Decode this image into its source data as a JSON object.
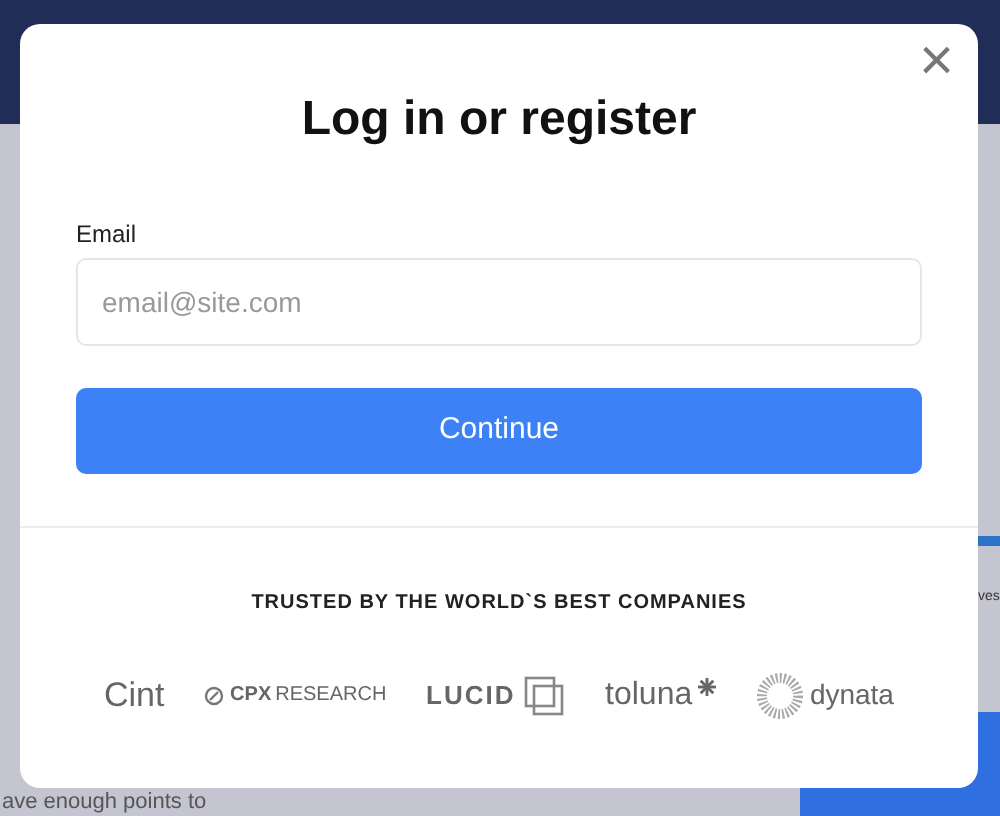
{
  "background": {
    "text_fragment": "ave enough points to",
    "side_fragment": "ves"
  },
  "modal": {
    "title": "Log in or register",
    "close": "×",
    "email": {
      "label": "Email",
      "placeholder": "email@site.com"
    },
    "button": "Continue",
    "trusted_title": "TRUSTED BY THE WORLD`S BEST COMPANIES",
    "logos": [
      {
        "kind": "cint",
        "text": "Cint"
      },
      {
        "kind": "cpx",
        "text": "CPX",
        "text2": "RESEARCH"
      },
      {
        "kind": "lucid",
        "text": "LUCID"
      },
      {
        "kind": "toluna",
        "text": "toluna"
      },
      {
        "kind": "dynata",
        "text": "dynata"
      }
    ]
  }
}
